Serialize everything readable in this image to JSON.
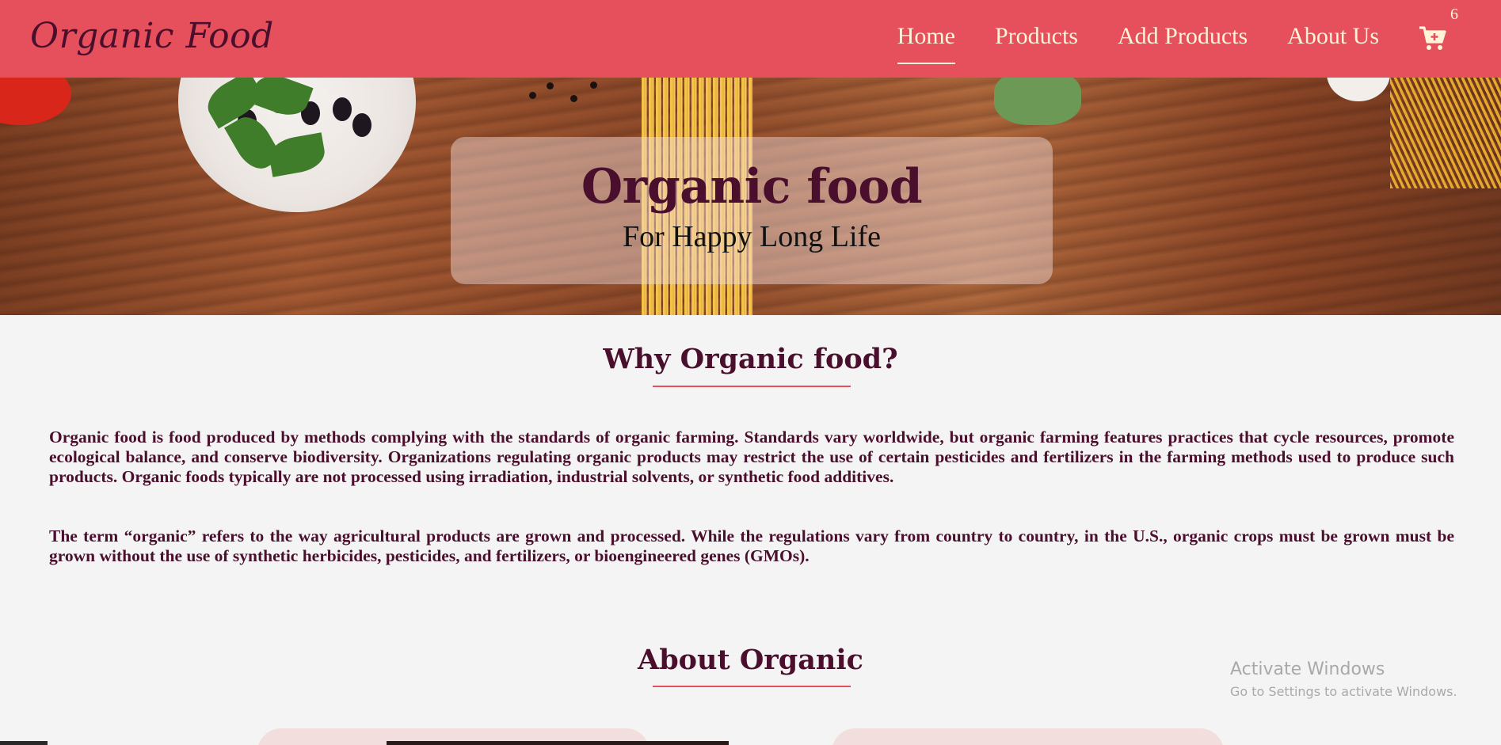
{
  "navbar": {
    "brand": "Organic Food",
    "links": [
      {
        "label": "Home",
        "active": true
      },
      {
        "label": "Products",
        "active": false
      },
      {
        "label": "Add Products",
        "active": false
      },
      {
        "label": "About Us",
        "active": false
      }
    ],
    "cart": {
      "icon": "cart-plus-icon",
      "count": "6"
    }
  },
  "hero": {
    "title": "Organic food",
    "subtitle": "For Happy Long Life"
  },
  "why": {
    "title": "Why Organic food?",
    "paragraphs": [
      "Organic food is food produced by methods complying with the standards of organic farming. Standards vary worldwide, but organic farming features practices that cycle resources, promote ecological balance, and conserve biodiversity. Organizations regulating organic products may restrict the use of certain pesticides and fertilizers in the farming methods used to produce such products. Organic foods typically are not processed using irradiation, industrial solvents, or synthetic food additives.",
      "The term “organic” refers to the way agricultural products are grown and processed. While the regulations vary from country to country, in the U.S., organic crops must be grown must be grown without the use of synthetic herbicides, pesticides, and fertilizers, or bioengineered genes (GMOs)."
    ]
  },
  "about": {
    "title": "About Organic"
  },
  "watermark": {
    "title": "Activate Windows",
    "subtitle": "Go to Settings to activate Windows."
  },
  "colors": {
    "nav_bg": "#e5505c",
    "brand_text": "#4a0f2c",
    "nav_text": "#fff3d8",
    "page_bg": "#f4f4f4"
  }
}
